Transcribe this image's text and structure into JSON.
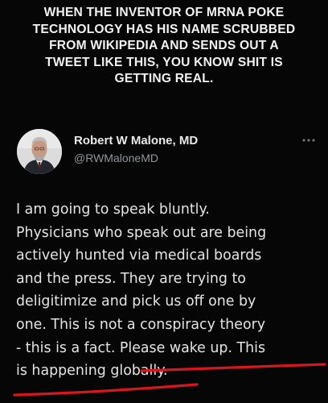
{
  "caption": {
    "lines": [
      "WHEN THE INVENTOR OF MRNA POKE",
      "TECHNOLOGY HAS HIS NAME SCRUBBED",
      "FROM WIKIPEDIA AND SENDS OUT A",
      "TWEET LIKE THIS, YOU KNOW SHIT IS",
      "GETTING REAL."
    ]
  },
  "tweet": {
    "author_name": "Robert W Malone, MD",
    "author_handle": "@RWMaloneMD",
    "more_icon": "more-horizontal-icon",
    "body_lines": [
      "I am going to speak bluntly.",
      "Physicians who speak out are being",
      "actively hunted via medical boards",
      "and the press.  They are trying to",
      "deligitimize and pick us off one by",
      "one.  This is not a conspiracy theory",
      "- this is a fact. Please wake up. This",
      "is happening globally."
    ]
  },
  "colors": {
    "background": "#060606",
    "text": "#e4e4e4",
    "handle": "#8f959b",
    "underline": "#d8161f"
  }
}
